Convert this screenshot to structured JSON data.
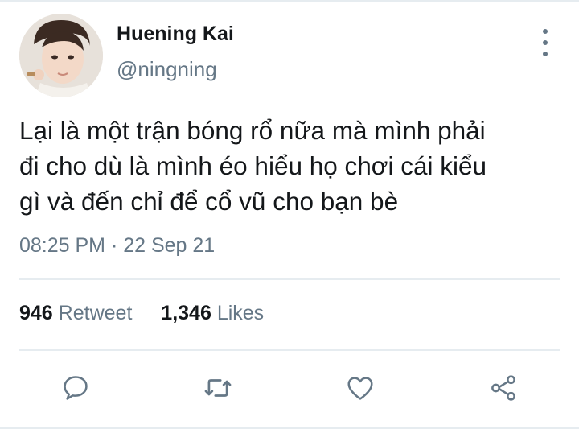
{
  "tweet": {
    "author": {
      "name": "Huening Kai",
      "handle": "@ningning"
    },
    "text_lines": [
      "Lại là một trận bóng rổ nữa mà mình phải",
      "đi cho dù là mình éo hiểu họ chơi cái kiểu",
      "gì và đến chỉ để cổ vũ cho bạn bè"
    ],
    "timestamp": "08:25 PM · 22 Sep 21",
    "stats": {
      "retweets_count": "946",
      "retweets_label": "Retweet",
      "likes_count": "1,346",
      "likes_label": "Likes"
    },
    "actions": [
      "reply-icon",
      "retweet-icon",
      "like-icon",
      "share-icon"
    ]
  },
  "colors": {
    "text": "#14171a",
    "secondary": "#657786",
    "divider": "#e6ecf0",
    "background": "#ffffff"
  }
}
